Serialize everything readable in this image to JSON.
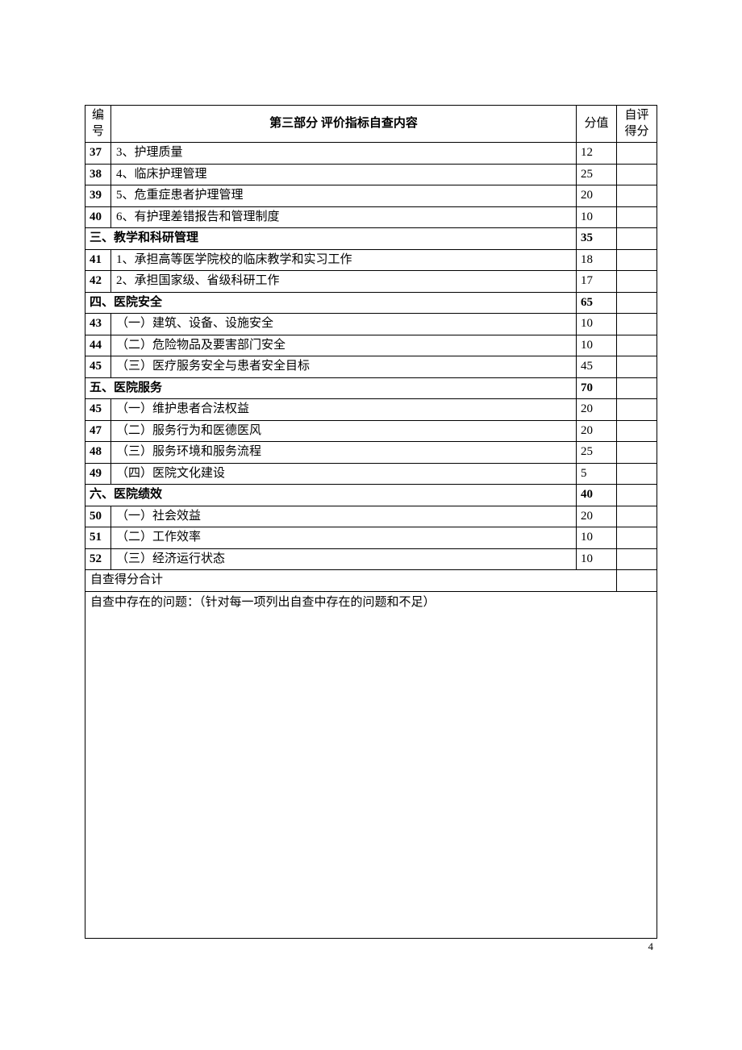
{
  "header": {
    "col_id": "编号",
    "col_content": "第三部分  评价指标自查内容",
    "col_score": "分值",
    "col_self": "自评得分"
  },
  "rows": [
    {
      "type": "item",
      "id": "37",
      "content": "3、护理质量",
      "score": "12",
      "self": ""
    },
    {
      "type": "item",
      "id": "38",
      "content": "4、临床护理管理",
      "score": "25",
      "self": ""
    },
    {
      "type": "item",
      "id": "39",
      "content": "5、危重症患者护理管理",
      "score": "20",
      "self": ""
    },
    {
      "type": "item",
      "id": "40",
      "content": "6、有护理差错报告和管理制度",
      "score": "10",
      "self": ""
    },
    {
      "type": "section",
      "label": "三、教学和科研管理",
      "score": "35",
      "self": ""
    },
    {
      "type": "item",
      "id": "41",
      "content": "1、承担高等医学院校的临床教学和实习工作",
      "score": "18",
      "self": ""
    },
    {
      "type": "item",
      "id": "42",
      "content": "2、承担国家级、省级科研工作",
      "score": "17",
      "self": ""
    },
    {
      "type": "section",
      "label": "四、医院安全",
      "score": "65",
      "self": ""
    },
    {
      "type": "item",
      "id": "43",
      "content": "（一）建筑、设备、设施安全",
      "score": "10",
      "self": ""
    },
    {
      "type": "item",
      "id": "44",
      "content": "（二）危险物品及要害部门安全",
      "score": "10",
      "self": ""
    },
    {
      "type": "item",
      "id": "45",
      "content": "（三）医疗服务安全与患者安全目标",
      "score": "45",
      "self": ""
    },
    {
      "type": "section",
      "label": "五、医院服务",
      "score": "70",
      "self": ""
    },
    {
      "type": "item",
      "id": "45",
      "content": "（一）维护患者合法权益",
      "score": "20",
      "self": ""
    },
    {
      "type": "item",
      "id": "47",
      "content": "（二）服务行为和医德医风",
      "score": "20",
      "self": ""
    },
    {
      "type": "item",
      "id": "48",
      "content": "（三）服务环境和服务流程",
      "score": "25",
      "self": ""
    },
    {
      "type": "item",
      "id": "49",
      "content": "（四）医院文化建设",
      "score": "5",
      "self": ""
    },
    {
      "type": "section",
      "label": "六、医院绩效",
      "score": "40",
      "self": ""
    },
    {
      "type": "item",
      "id": "50",
      "content": "（一）社会效益",
      "score": "20",
      "self": ""
    },
    {
      "type": "item",
      "id": "51",
      "content": "（二）工作效率",
      "score": "10",
      "self": ""
    },
    {
      "type": "item",
      "id": "52",
      "content": "（三）经济运行状态",
      "score": "10",
      "self": ""
    }
  ],
  "total_label": "自查得分合计",
  "notes_label": "自查中存在的问题：（针对每一项列出自查中存在的问题和不足）",
  "page_number": "4"
}
